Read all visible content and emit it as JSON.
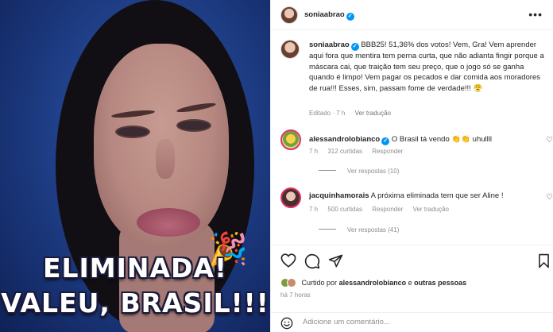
{
  "post": {
    "author": "soniaabrao",
    "caption": {
      "prefix": "BBB25! 51,36% dos votos! Vem, Gra! Vem aprender aqui fora que mentira tem perna curta, que não adianta fingir porque a máscara cai, que traição tem seu preço, que o jogo só se ganha quando é limpo! Vem pagar os pecados e dar comida aos moradores de rua!!! Esses, sim, passam fome de verdade!!!",
      "emoji": "😤",
      "edited": "Editado · 7 h",
      "translate": "Ver tradução"
    },
    "media": {
      "line1": "ELIMINADA!",
      "line2": "VALEU, BRASIL!!!",
      "party_emoji": "🎉"
    }
  },
  "comments": [
    {
      "user": "alessandrolobianco",
      "text": "O Brasil tá vendo 👏👏 uhullll",
      "time": "7 h",
      "likes": "312 curtidas",
      "reply": "Responder",
      "translate": "",
      "view_replies": "Ver respostas (10)"
    },
    {
      "user": "jacquinhamorais",
      "text": "A próxima eliminada tem que ser Aline !",
      "time": "7 h",
      "likes": "500 curtidas",
      "reply": "Responder",
      "translate": "Ver tradução",
      "view_replies": "Ver respostas (41)"
    }
  ],
  "footer": {
    "liked_prefix": "Curtido por",
    "liked_user": "alessandrolobianco",
    "liked_connector": "e",
    "liked_others": "outras pessoas",
    "time_ago": "há 7 horas",
    "comment_placeholder": "Adicione um comentário..."
  },
  "icons": {
    "verified": "verified-badge-icon",
    "more": "more-options-icon",
    "heart": "heart-icon",
    "comment": "comment-icon",
    "share": "share-icon",
    "save": "bookmark-icon",
    "emoji": "emoji-icon"
  },
  "colors": {
    "verified": "#0095f6",
    "secondary_text": "#8e8e8e",
    "story_ring": "#e1306c"
  }
}
